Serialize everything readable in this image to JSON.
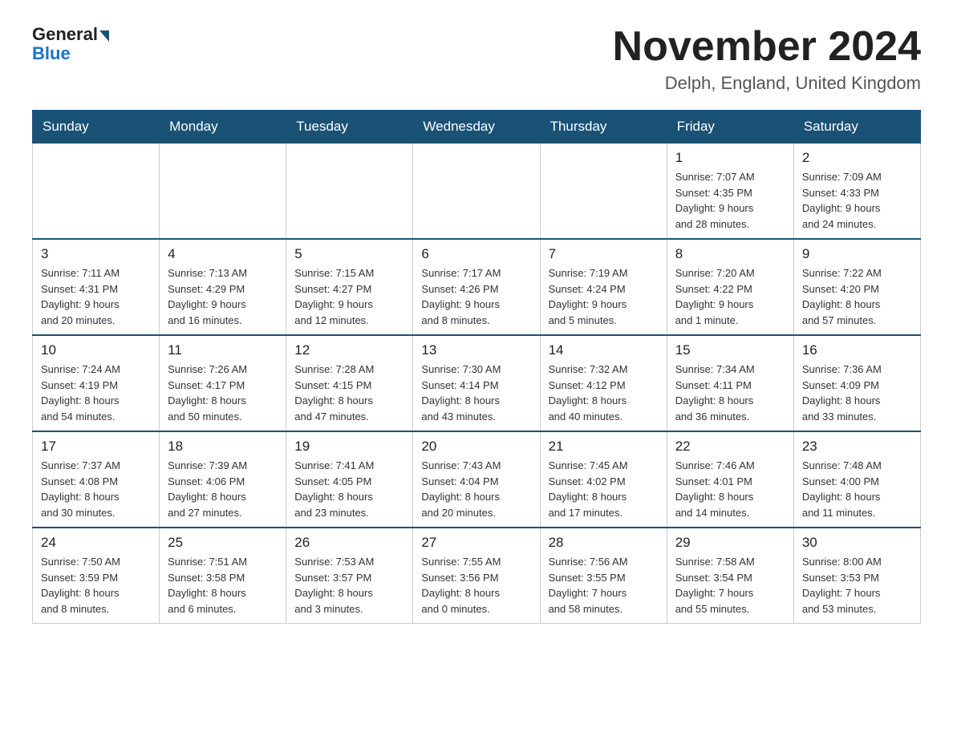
{
  "header": {
    "logo_general": "General",
    "logo_blue": "Blue",
    "month_title": "November 2024",
    "subtitle": "Delph, England, United Kingdom"
  },
  "weekdays": [
    "Sunday",
    "Monday",
    "Tuesday",
    "Wednesday",
    "Thursday",
    "Friday",
    "Saturday"
  ],
  "weeks": [
    [
      {
        "day": "",
        "info": ""
      },
      {
        "day": "",
        "info": ""
      },
      {
        "day": "",
        "info": ""
      },
      {
        "day": "",
        "info": ""
      },
      {
        "day": "",
        "info": ""
      },
      {
        "day": "1",
        "info": "Sunrise: 7:07 AM\nSunset: 4:35 PM\nDaylight: 9 hours\nand 28 minutes."
      },
      {
        "day": "2",
        "info": "Sunrise: 7:09 AM\nSunset: 4:33 PM\nDaylight: 9 hours\nand 24 minutes."
      }
    ],
    [
      {
        "day": "3",
        "info": "Sunrise: 7:11 AM\nSunset: 4:31 PM\nDaylight: 9 hours\nand 20 minutes."
      },
      {
        "day": "4",
        "info": "Sunrise: 7:13 AM\nSunset: 4:29 PM\nDaylight: 9 hours\nand 16 minutes."
      },
      {
        "day": "5",
        "info": "Sunrise: 7:15 AM\nSunset: 4:27 PM\nDaylight: 9 hours\nand 12 minutes."
      },
      {
        "day": "6",
        "info": "Sunrise: 7:17 AM\nSunset: 4:26 PM\nDaylight: 9 hours\nand 8 minutes."
      },
      {
        "day": "7",
        "info": "Sunrise: 7:19 AM\nSunset: 4:24 PM\nDaylight: 9 hours\nand 5 minutes."
      },
      {
        "day": "8",
        "info": "Sunrise: 7:20 AM\nSunset: 4:22 PM\nDaylight: 9 hours\nand 1 minute."
      },
      {
        "day": "9",
        "info": "Sunrise: 7:22 AM\nSunset: 4:20 PM\nDaylight: 8 hours\nand 57 minutes."
      }
    ],
    [
      {
        "day": "10",
        "info": "Sunrise: 7:24 AM\nSunset: 4:19 PM\nDaylight: 8 hours\nand 54 minutes."
      },
      {
        "day": "11",
        "info": "Sunrise: 7:26 AM\nSunset: 4:17 PM\nDaylight: 8 hours\nand 50 minutes."
      },
      {
        "day": "12",
        "info": "Sunrise: 7:28 AM\nSunset: 4:15 PM\nDaylight: 8 hours\nand 47 minutes."
      },
      {
        "day": "13",
        "info": "Sunrise: 7:30 AM\nSunset: 4:14 PM\nDaylight: 8 hours\nand 43 minutes."
      },
      {
        "day": "14",
        "info": "Sunrise: 7:32 AM\nSunset: 4:12 PM\nDaylight: 8 hours\nand 40 minutes."
      },
      {
        "day": "15",
        "info": "Sunrise: 7:34 AM\nSunset: 4:11 PM\nDaylight: 8 hours\nand 36 minutes."
      },
      {
        "day": "16",
        "info": "Sunrise: 7:36 AM\nSunset: 4:09 PM\nDaylight: 8 hours\nand 33 minutes."
      }
    ],
    [
      {
        "day": "17",
        "info": "Sunrise: 7:37 AM\nSunset: 4:08 PM\nDaylight: 8 hours\nand 30 minutes."
      },
      {
        "day": "18",
        "info": "Sunrise: 7:39 AM\nSunset: 4:06 PM\nDaylight: 8 hours\nand 27 minutes."
      },
      {
        "day": "19",
        "info": "Sunrise: 7:41 AM\nSunset: 4:05 PM\nDaylight: 8 hours\nand 23 minutes."
      },
      {
        "day": "20",
        "info": "Sunrise: 7:43 AM\nSunset: 4:04 PM\nDaylight: 8 hours\nand 20 minutes."
      },
      {
        "day": "21",
        "info": "Sunrise: 7:45 AM\nSunset: 4:02 PM\nDaylight: 8 hours\nand 17 minutes."
      },
      {
        "day": "22",
        "info": "Sunrise: 7:46 AM\nSunset: 4:01 PM\nDaylight: 8 hours\nand 14 minutes."
      },
      {
        "day": "23",
        "info": "Sunrise: 7:48 AM\nSunset: 4:00 PM\nDaylight: 8 hours\nand 11 minutes."
      }
    ],
    [
      {
        "day": "24",
        "info": "Sunrise: 7:50 AM\nSunset: 3:59 PM\nDaylight: 8 hours\nand 8 minutes."
      },
      {
        "day": "25",
        "info": "Sunrise: 7:51 AM\nSunset: 3:58 PM\nDaylight: 8 hours\nand 6 minutes."
      },
      {
        "day": "26",
        "info": "Sunrise: 7:53 AM\nSunset: 3:57 PM\nDaylight: 8 hours\nand 3 minutes."
      },
      {
        "day": "27",
        "info": "Sunrise: 7:55 AM\nSunset: 3:56 PM\nDaylight: 8 hours\nand 0 minutes."
      },
      {
        "day": "28",
        "info": "Sunrise: 7:56 AM\nSunset: 3:55 PM\nDaylight: 7 hours\nand 58 minutes."
      },
      {
        "day": "29",
        "info": "Sunrise: 7:58 AM\nSunset: 3:54 PM\nDaylight: 7 hours\nand 55 minutes."
      },
      {
        "day": "30",
        "info": "Sunrise: 8:00 AM\nSunset: 3:53 PM\nDaylight: 7 hours\nand 53 minutes."
      }
    ]
  ]
}
